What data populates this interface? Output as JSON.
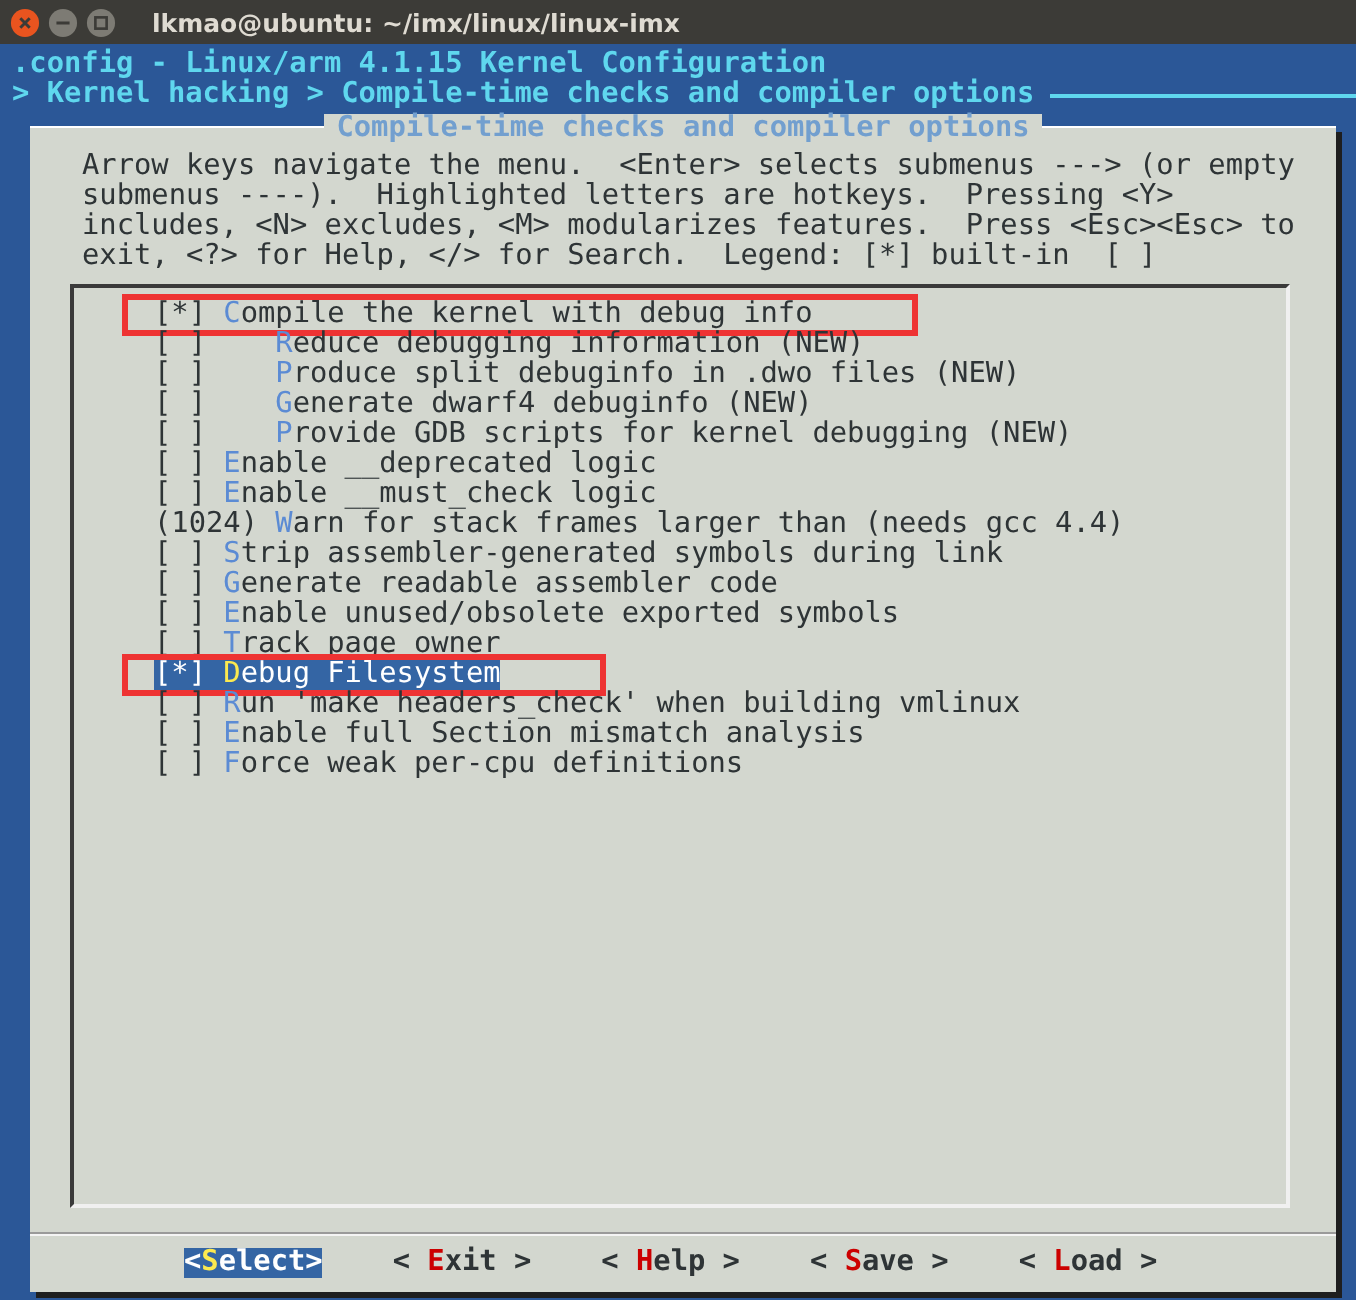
{
  "window": {
    "title": "lkmao@ubuntu: ~/imx/linux/linux-imx"
  },
  "header": {
    "config_line": ".config - Linux/arm 4.1.15 Kernel Configuration",
    "breadcrumb": "> Kernel hacking > Compile-time checks and compiler options"
  },
  "dialog": {
    "title": "Compile-time checks and compiler options",
    "help_lines": [
      "Arrow keys navigate the menu.  <Enter> selects submenus ---> (or empty",
      "submenus ----).  Highlighted letters are hotkeys.  Pressing <Y>",
      "includes, <N> excludes, <M> modularizes features.  Press <Esc><Esc> to",
      "exit, <?> for Help, </> for Search.  Legend: [*] built-in  [ ]"
    ],
    "items": [
      {
        "marker": "[*]",
        "label": "Compile the kernel with debug info",
        "selected": false,
        "annotated": true,
        "children": [
          {
            "marker": "[ ]",
            "label": "Reduce debugging information (NEW)",
            "selected": false,
            "annotated": false
          },
          {
            "marker": "[ ]",
            "label": "Produce split debuginfo in .dwo files (NEW)",
            "selected": false,
            "annotated": false
          },
          {
            "marker": "[ ]",
            "label": "Generate dwarf4 debuginfo (NEW)",
            "selected": false,
            "annotated": false
          },
          {
            "marker": "[ ]",
            "label": "Provide GDB scripts for kernel debugging (NEW)",
            "selected": false,
            "annotated": false
          }
        ]
      },
      {
        "marker": "[ ]",
        "label": "Enable __deprecated logic",
        "selected": false,
        "annotated": false
      },
      {
        "marker": "[ ]",
        "label": "Enable __must_check logic",
        "selected": false,
        "annotated": false
      },
      {
        "marker": "(1024)",
        "label": "Warn for stack frames larger than (needs gcc 4.4)",
        "selected": false,
        "annotated": false
      },
      {
        "marker": "[ ]",
        "label": "Strip assembler-generated symbols during link",
        "selected": false,
        "annotated": false
      },
      {
        "marker": "[ ]",
        "label": "Generate readable assembler code",
        "selected": false,
        "annotated": false
      },
      {
        "marker": "[ ]",
        "label": "Enable unused/obsolete exported symbols",
        "selected": false,
        "annotated": false
      },
      {
        "marker": "[ ]",
        "label": "Track page owner",
        "selected": false,
        "annotated": false
      },
      {
        "marker": "[*]",
        "label": "Debug Filesystem",
        "selected": true,
        "annotated": true
      },
      {
        "marker": "[ ]",
        "label": "Run 'make headers_check' when building vmlinux",
        "selected": false,
        "annotated": false
      },
      {
        "marker": "[ ]",
        "label": "Enable full Section mismatch analysis",
        "selected": false,
        "annotated": false
      },
      {
        "marker": "[ ]",
        "label": "Force weak per-cpu definitions",
        "selected": false,
        "annotated": false
      }
    ],
    "buttons": [
      {
        "text": "<Select>",
        "selected": true
      },
      {
        "text": "< Exit >",
        "selected": false
      },
      {
        "text": "< Help >",
        "selected": false
      },
      {
        "text": "< Save >",
        "selected": false
      },
      {
        "text": "< Load >",
        "selected": false
      }
    ]
  }
}
